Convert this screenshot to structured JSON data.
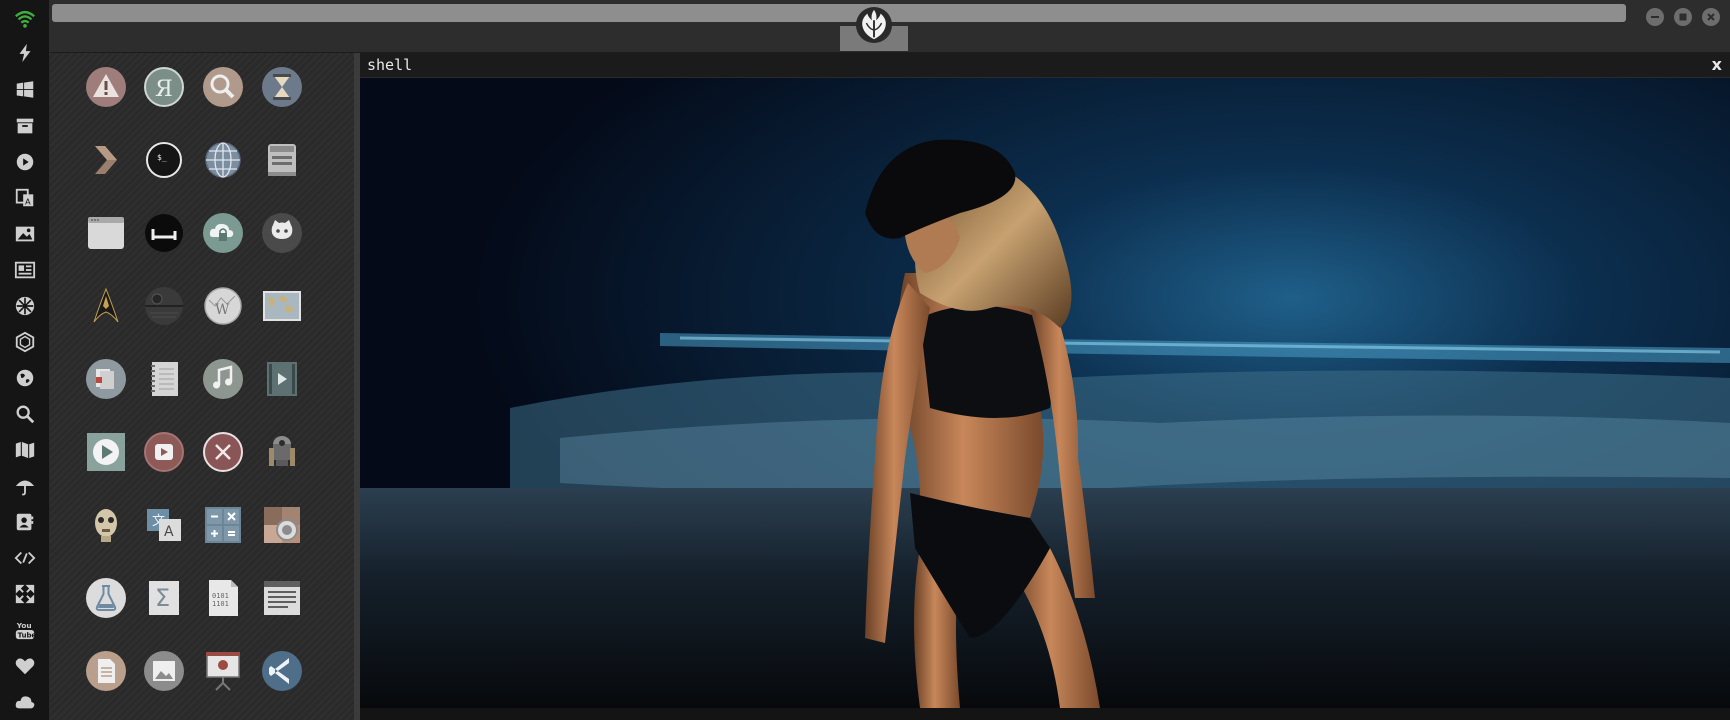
{
  "shell": {
    "title": "shell",
    "close_label": "x"
  },
  "topbar": {
    "center_logo": "rebel-alliance-icon",
    "window_buttons": [
      "minimize-icon",
      "maximize-icon",
      "close-icon"
    ]
  },
  "dock": {
    "items": [
      "wifi-icon",
      "lightning-icon",
      "windows-icon",
      "archive-icon",
      "play-icon",
      "translate-icon",
      "image-icon",
      "news-icon",
      "empire-icon",
      "hexagon-icon",
      "globe-icon",
      "search-icon",
      "map-icon",
      "umbrella-icon",
      "contacts-icon",
      "code-icon",
      "fullscreen-icon",
      "youtube-icon",
      "heart-icon",
      "cloud-icon"
    ]
  },
  "launcher": {
    "apps": [
      "warning-icon",
      "yandex-icon",
      "magnifier-icon",
      "hourglass-icon",
      "chevron-icon",
      "terminal-icon",
      "globe-network-icon",
      "drive-icon",
      "browser-window-icon",
      "bed-icon",
      "cloud-lock-icon",
      "github-icon",
      "starfleet-icon",
      "death-star-icon",
      "wikipedia-icon",
      "world-map-icon",
      "file-manager-icon",
      "notebook-icon",
      "music-icon",
      "video-icon",
      "media-player-icon",
      "video-player-icon",
      "close-circle-icon",
      "r2d2-icon",
      "c3po-icon",
      "translator-icon",
      "calculator-icon",
      "camera-icon",
      "flask-icon",
      "sigma-icon",
      "binary-file-icon",
      "text-editor-icon",
      "document-icon",
      "picture-icon",
      "presentation-icon",
      "vscode-icon"
    ]
  },
  "colors": {
    "dock_bg": "#151515",
    "panel_bg": "#2a2a2a",
    "topbar_bg": "#2d2d2d",
    "shell_bg": "#141414"
  }
}
